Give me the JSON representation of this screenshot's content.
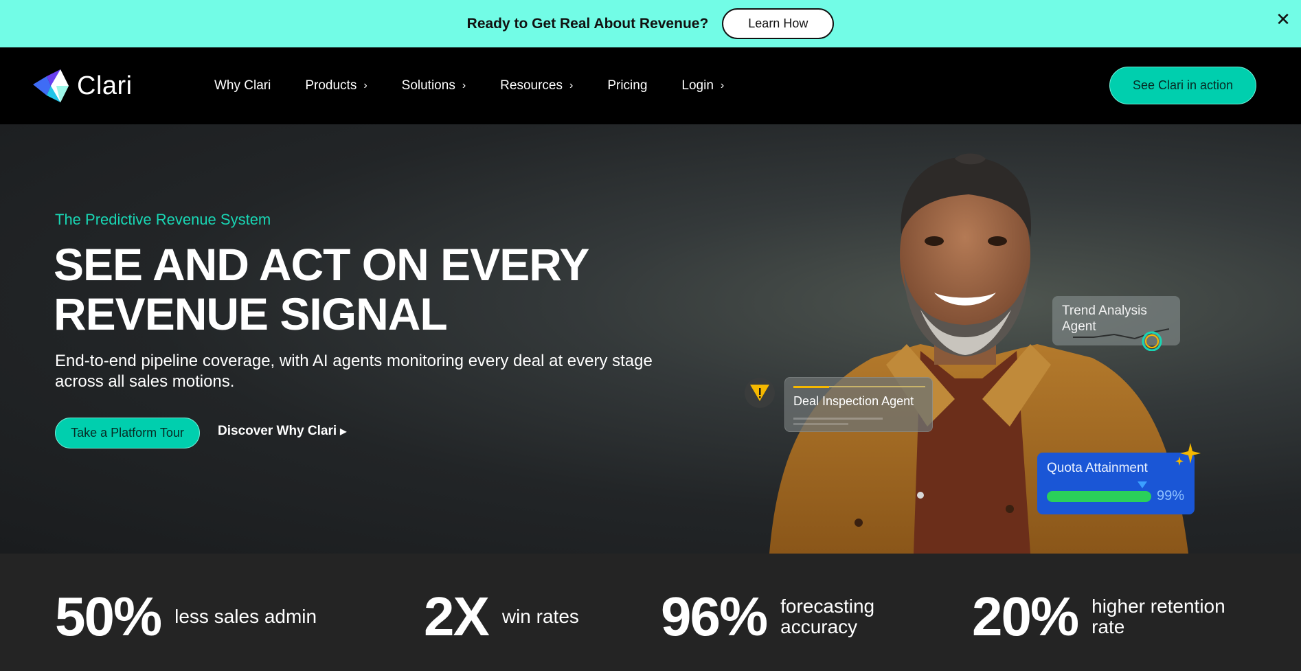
{
  "announcement": {
    "text": "Ready to Get Real About Revenue?",
    "button": "Learn How",
    "close": "✕"
  },
  "nav": {
    "logo_text": "Clari",
    "items": [
      {
        "label": "Why Clari",
        "has_menu": false
      },
      {
        "label": "Products",
        "has_menu": true
      },
      {
        "label": "Solutions",
        "has_menu": true
      },
      {
        "label": "Resources",
        "has_menu": true
      },
      {
        "label": "Pricing",
        "has_menu": false
      },
      {
        "label": "Login",
        "has_menu": true
      }
    ],
    "cta": "See Clari in action"
  },
  "hero": {
    "eyebrow": "The Predictive Revenue System",
    "headline_line1": "SEE AND ACT ON EVERY",
    "headline_line2": "REVENUE SIGNAL",
    "subtext": "End-to-end pipeline coverage, with AI agents monitoring every deal at every stage across all sales motions.",
    "primary_button": "Take a Platform Tour",
    "secondary_link": "Discover Why Clari",
    "cards": {
      "trend": "Trend Analysis Agent",
      "deal": "Deal Inspection Agent",
      "quota_title": "Quota Attainment",
      "quota_value": "99%",
      "quota_fraction": 0.99
    }
  },
  "stats": [
    {
      "value": "50%",
      "label": "less sales admin"
    },
    {
      "value": "2X",
      "label": "win rates"
    },
    {
      "value": "96%",
      "label": "forecasting accuracy"
    },
    {
      "value": "20%",
      "label": "higher retention rate"
    }
  ],
  "colors": {
    "announcement_bg": "#72fce6",
    "accent": "#00cfae",
    "eyebrow": "#19d6b4",
    "quota_card": "#1a56d6"
  }
}
